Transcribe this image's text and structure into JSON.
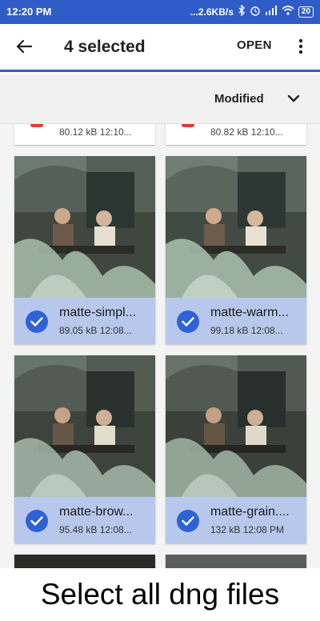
{
  "status_bar": {
    "time": "12:20 PM",
    "network_speed": "...2.6KB/s",
    "battery": "20",
    "bg_color": "#2f5cc7"
  },
  "app_bar": {
    "title": "4 selected",
    "open_label": "OPEN",
    "back_icon": "arrow-left-icon",
    "more_icon": "more-vert-icon"
  },
  "sort_bar": {
    "label": "Modified",
    "toggle_icon": "chevron-down-icon"
  },
  "files": {
    "partial_top": [
      {
        "meta": "80.12 kB 12:10..."
      },
      {
        "meta": "80.82 kB 12:10..."
      }
    ],
    "items": [
      {
        "name": "matte-simpl...",
        "meta": "89.05 kB 12:08...",
        "selected": true
      },
      {
        "name": "matte-warm...",
        "meta": "99.18 kB 12:08...",
        "selected": true
      },
      {
        "name": "matte-brow...",
        "meta": "95.48 kB 12:08...",
        "selected": true
      },
      {
        "name": "matte-grain....",
        "meta": "132 kB 12:08 PM",
        "selected": true
      }
    ]
  },
  "caption": "Select all dng files",
  "colors": {
    "accent": "#2f5cc7",
    "selected_footer": "#b8c8ec",
    "check": "#2f62d6"
  }
}
